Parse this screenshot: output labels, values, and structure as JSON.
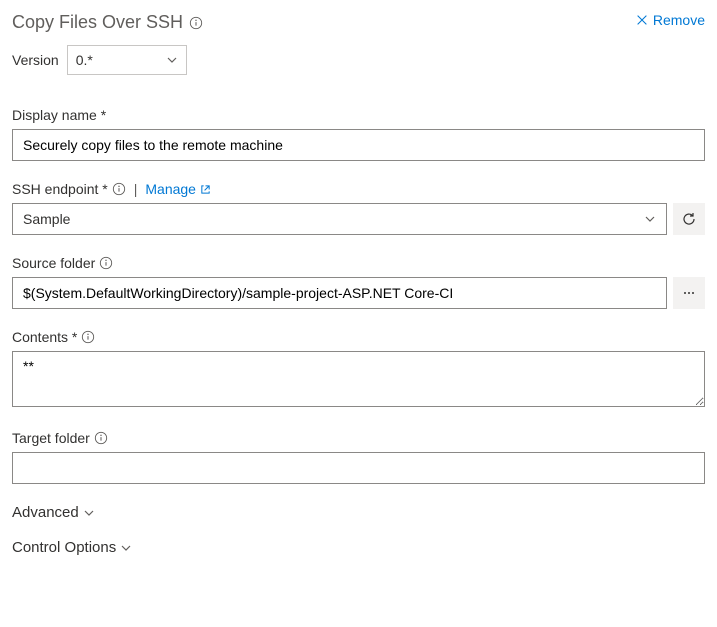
{
  "header": {
    "title": "Copy Files Over SSH",
    "remove_label": "Remove"
  },
  "version": {
    "label": "Version",
    "selected": "0.*"
  },
  "fields": {
    "display_name": {
      "label": "Display name *",
      "value": "Securely copy files to the remote machine"
    },
    "ssh_endpoint": {
      "label": "SSH endpoint *",
      "manage_label": "Manage",
      "value": "Sample"
    },
    "source_folder": {
      "label": "Source folder",
      "value": "$(System.DefaultWorkingDirectory)/sample-project-ASP.NET Core-CI"
    },
    "contents": {
      "label": "Contents *",
      "value": "**"
    },
    "target_folder": {
      "label": "Target folder",
      "value": ""
    }
  },
  "sections": {
    "advanced": "Advanced",
    "control_options": "Control Options"
  }
}
